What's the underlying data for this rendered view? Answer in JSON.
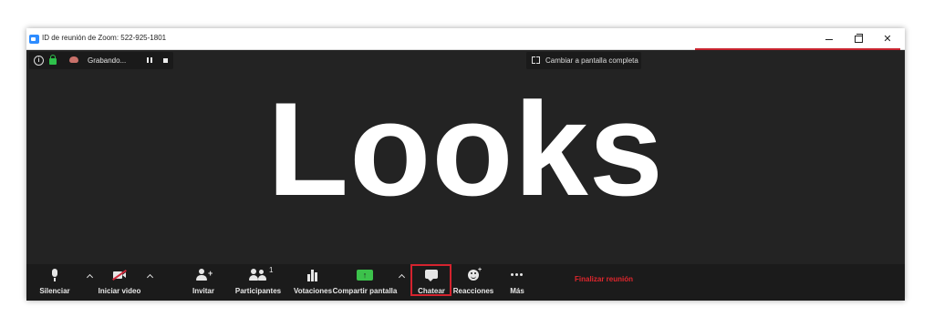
{
  "window": {
    "title": "ID de reunión de Zoom: 522-925-1801",
    "accent_color": "#c8242f"
  },
  "status_bar": {
    "recording_text": "Grabando...",
    "info_icon": "info-icon",
    "lock_icon": "lock-icon",
    "record_icon": "cloud-record-icon"
  },
  "fullscreen": {
    "label": "Cambiar a pantalla completa"
  },
  "shared_screen": {
    "text": "Looks"
  },
  "toolbar": {
    "mute_label": "Silenciar",
    "video_label": "Iniciar video",
    "invite_label": "Invitar",
    "participants_label": "Participantes",
    "participants_count": "1",
    "polls_label": "Votaciones",
    "share_label": "Compartir pantalla",
    "chat_label": "Chatear",
    "reactions_label": "Reacciones",
    "more_label": "Más",
    "end_label": "Finalizar reunión",
    "end_color": "#e0262d",
    "share_color": "#3cc24b"
  }
}
